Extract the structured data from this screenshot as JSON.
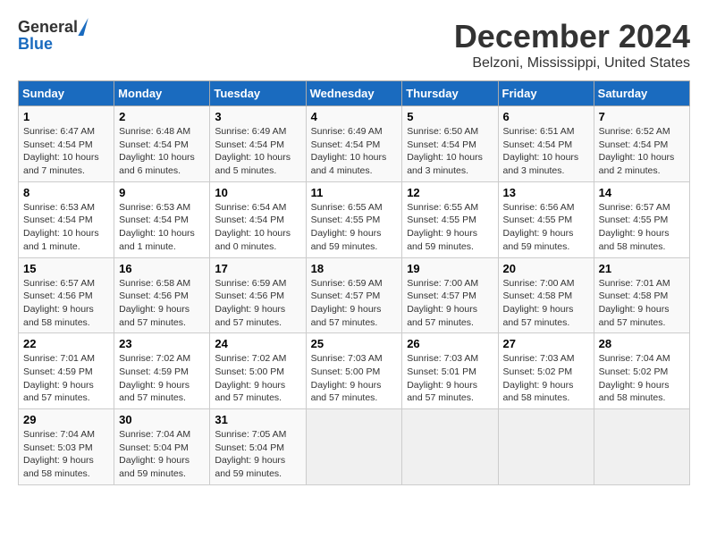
{
  "logo": {
    "general": "General",
    "blue": "Blue"
  },
  "title": "December 2024",
  "subtitle": "Belzoni, Mississippi, United States",
  "weekdays": [
    "Sunday",
    "Monday",
    "Tuesday",
    "Wednesday",
    "Thursday",
    "Friday",
    "Saturday"
  ],
  "weeks": [
    [
      {
        "day": "1",
        "info": "Sunrise: 6:47 AM\nSunset: 4:54 PM\nDaylight: 10 hours\nand 7 minutes."
      },
      {
        "day": "2",
        "info": "Sunrise: 6:48 AM\nSunset: 4:54 PM\nDaylight: 10 hours\nand 6 minutes."
      },
      {
        "day": "3",
        "info": "Sunrise: 6:49 AM\nSunset: 4:54 PM\nDaylight: 10 hours\nand 5 minutes."
      },
      {
        "day": "4",
        "info": "Sunrise: 6:49 AM\nSunset: 4:54 PM\nDaylight: 10 hours\nand 4 minutes."
      },
      {
        "day": "5",
        "info": "Sunrise: 6:50 AM\nSunset: 4:54 PM\nDaylight: 10 hours\nand 3 minutes."
      },
      {
        "day": "6",
        "info": "Sunrise: 6:51 AM\nSunset: 4:54 PM\nDaylight: 10 hours\nand 3 minutes."
      },
      {
        "day": "7",
        "info": "Sunrise: 6:52 AM\nSunset: 4:54 PM\nDaylight: 10 hours\nand 2 minutes."
      }
    ],
    [
      {
        "day": "8",
        "info": "Sunrise: 6:53 AM\nSunset: 4:54 PM\nDaylight: 10 hours\nand 1 minute."
      },
      {
        "day": "9",
        "info": "Sunrise: 6:53 AM\nSunset: 4:54 PM\nDaylight: 10 hours\nand 1 minute."
      },
      {
        "day": "10",
        "info": "Sunrise: 6:54 AM\nSunset: 4:54 PM\nDaylight: 10 hours\nand 0 minutes."
      },
      {
        "day": "11",
        "info": "Sunrise: 6:55 AM\nSunset: 4:55 PM\nDaylight: 9 hours\nand 59 minutes."
      },
      {
        "day": "12",
        "info": "Sunrise: 6:55 AM\nSunset: 4:55 PM\nDaylight: 9 hours\nand 59 minutes."
      },
      {
        "day": "13",
        "info": "Sunrise: 6:56 AM\nSunset: 4:55 PM\nDaylight: 9 hours\nand 59 minutes."
      },
      {
        "day": "14",
        "info": "Sunrise: 6:57 AM\nSunset: 4:55 PM\nDaylight: 9 hours\nand 58 minutes."
      }
    ],
    [
      {
        "day": "15",
        "info": "Sunrise: 6:57 AM\nSunset: 4:56 PM\nDaylight: 9 hours\nand 58 minutes."
      },
      {
        "day": "16",
        "info": "Sunrise: 6:58 AM\nSunset: 4:56 PM\nDaylight: 9 hours\nand 57 minutes."
      },
      {
        "day": "17",
        "info": "Sunrise: 6:59 AM\nSunset: 4:56 PM\nDaylight: 9 hours\nand 57 minutes."
      },
      {
        "day": "18",
        "info": "Sunrise: 6:59 AM\nSunset: 4:57 PM\nDaylight: 9 hours\nand 57 minutes."
      },
      {
        "day": "19",
        "info": "Sunrise: 7:00 AM\nSunset: 4:57 PM\nDaylight: 9 hours\nand 57 minutes."
      },
      {
        "day": "20",
        "info": "Sunrise: 7:00 AM\nSunset: 4:58 PM\nDaylight: 9 hours\nand 57 minutes."
      },
      {
        "day": "21",
        "info": "Sunrise: 7:01 AM\nSunset: 4:58 PM\nDaylight: 9 hours\nand 57 minutes."
      }
    ],
    [
      {
        "day": "22",
        "info": "Sunrise: 7:01 AM\nSunset: 4:59 PM\nDaylight: 9 hours\nand 57 minutes."
      },
      {
        "day": "23",
        "info": "Sunrise: 7:02 AM\nSunset: 4:59 PM\nDaylight: 9 hours\nand 57 minutes."
      },
      {
        "day": "24",
        "info": "Sunrise: 7:02 AM\nSunset: 5:00 PM\nDaylight: 9 hours\nand 57 minutes."
      },
      {
        "day": "25",
        "info": "Sunrise: 7:03 AM\nSunset: 5:00 PM\nDaylight: 9 hours\nand 57 minutes."
      },
      {
        "day": "26",
        "info": "Sunrise: 7:03 AM\nSunset: 5:01 PM\nDaylight: 9 hours\nand 57 minutes."
      },
      {
        "day": "27",
        "info": "Sunrise: 7:03 AM\nSunset: 5:02 PM\nDaylight: 9 hours\nand 58 minutes."
      },
      {
        "day": "28",
        "info": "Sunrise: 7:04 AM\nSunset: 5:02 PM\nDaylight: 9 hours\nand 58 minutes."
      }
    ],
    [
      {
        "day": "29",
        "info": "Sunrise: 7:04 AM\nSunset: 5:03 PM\nDaylight: 9 hours\nand 58 minutes."
      },
      {
        "day": "30",
        "info": "Sunrise: 7:04 AM\nSunset: 5:04 PM\nDaylight: 9 hours\nand 59 minutes."
      },
      {
        "day": "31",
        "info": "Sunrise: 7:05 AM\nSunset: 5:04 PM\nDaylight: 9 hours\nand 59 minutes."
      },
      null,
      null,
      null,
      null
    ]
  ]
}
